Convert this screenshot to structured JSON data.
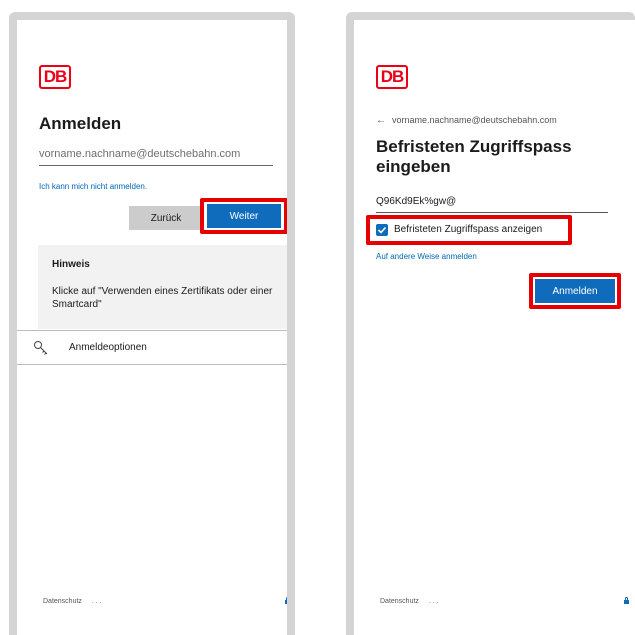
{
  "left": {
    "logo": "DB",
    "title": "Anmelden",
    "email_placeholder": "vorname.nachname@deutschebahn.com",
    "cant_signin_link": "Ich kann mich nicht anmelden.",
    "back_button": "Zurück",
    "next_button": "Weiter",
    "notice": {
      "title": "Hinweis",
      "body": "Klicke auf \"Verwenden eines Zertifikats oder einer Smartcard\""
    },
    "signin_options": "Anmeldeoptionen",
    "footer": {
      "privacy": "Datenschutz",
      "more": "..."
    }
  },
  "right": {
    "logo": "DB",
    "back_email": "vorname.nachname@deutschebahn.com",
    "title_line1": "Befristeten Zugriffspass",
    "title_line2": "eingeben",
    "pass_value": "Q96Kd9Ek%gw@",
    "show_pass_label": "Befristeten Zugriffspass anzeigen",
    "show_pass_checked": true,
    "other_signin_link": "Auf andere Weise anmelden",
    "signin_button": "Anmelden",
    "footer": {
      "privacy": "Datenschutz",
      "more": "..."
    }
  },
  "colors": {
    "brand_red": "#ec0016",
    "primary_blue": "#0f6cbd",
    "highlight_red": "#e60000"
  }
}
